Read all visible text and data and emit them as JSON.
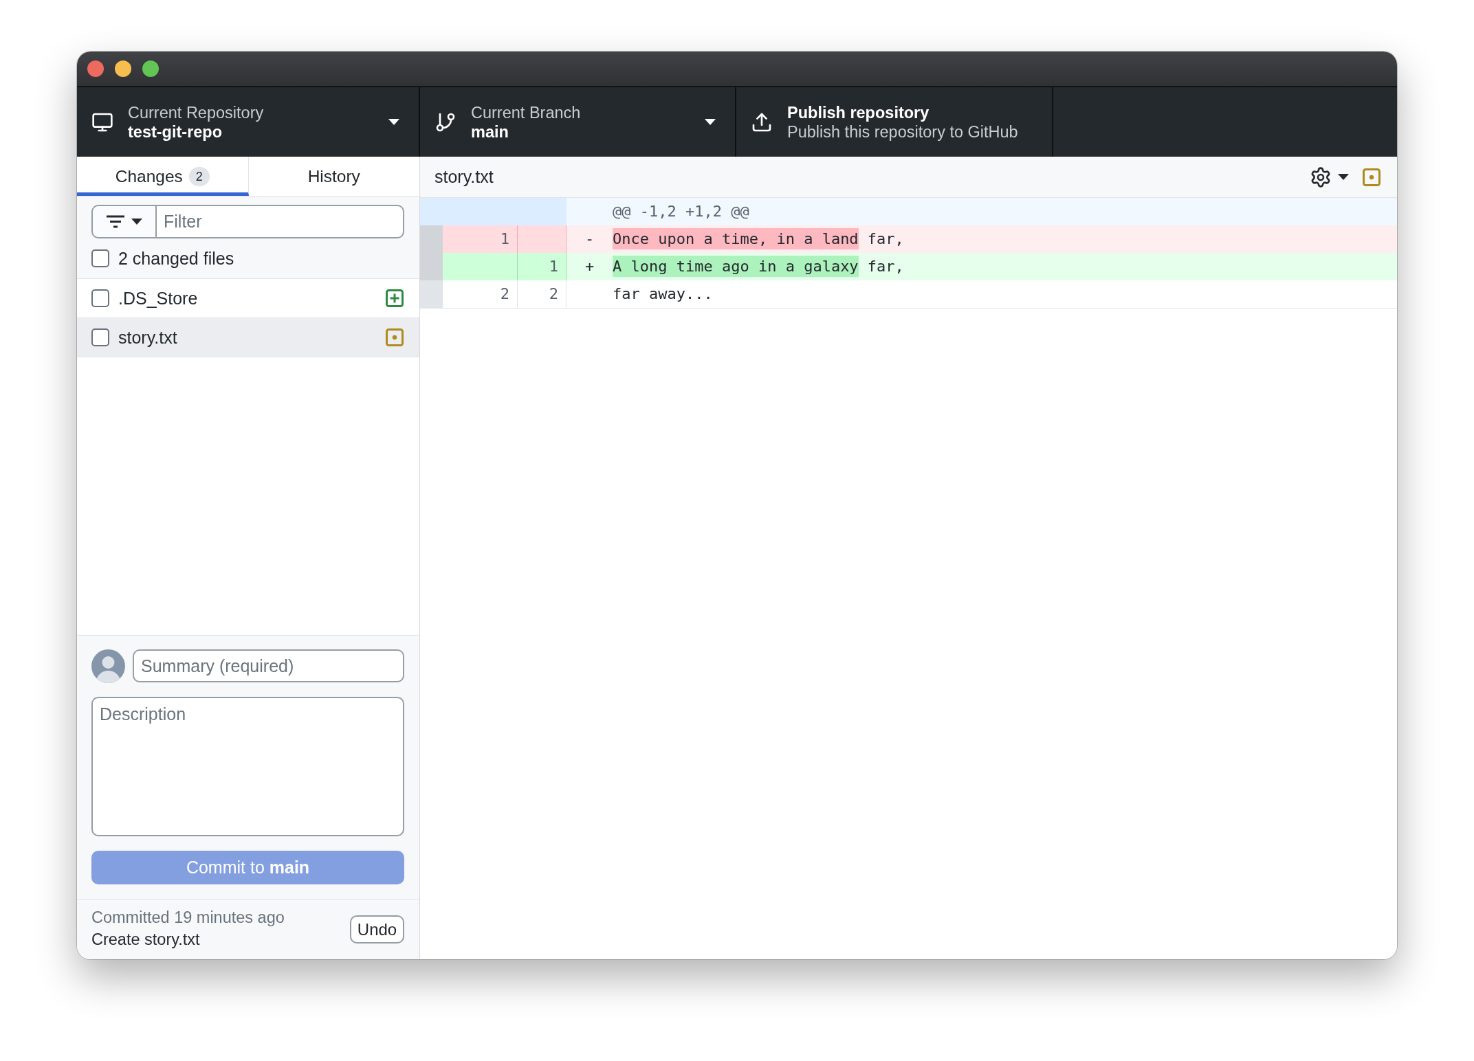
{
  "toolbar": [
    {
      "kind": "repository",
      "label": "Current Repository",
      "value": "test-git-repo",
      "dropdown": true
    },
    {
      "kind": "branch",
      "label": "Current Branch",
      "value": "main",
      "dropdown": true
    },
    {
      "kind": "publish",
      "title": "Publish repository",
      "description": "Publish this repository to GitHub"
    }
  ],
  "sidebar": {
    "tabs": [
      {
        "label": "Changes",
        "count": "2",
        "selected": true
      },
      {
        "label": "History",
        "selected": false
      }
    ],
    "filter": {
      "placeholder": "Filter"
    },
    "select_all": {
      "label": "2 changed files",
      "checked": false
    },
    "files": [
      {
        "name": ".DS_Store",
        "kind": "added",
        "checked": false,
        "selected": false
      },
      {
        "name": "story.txt",
        "kind": "modified",
        "checked": false,
        "selected": true
      }
    ],
    "commit": {
      "summary": {
        "placeholder": "Summary (required)"
      },
      "description": {
        "placeholder": "Description"
      },
      "button": {
        "label": "Commit to **main**",
        "disabled": true
      }
    },
    "last_commit": {
      "status": "Committed 19 minutes ago",
      "message": "Create story.txt",
      "undo": "Undo"
    }
  },
  "diff": {
    "file": "story.txt",
    "hunk": "@@ -1,2 +1,2 @@",
    "lines": [
      {
        "kind": "deleted",
        "old": "1",
        "sign": "-",
        "segments": [
          {
            "text": "Once upon a time, in a land",
            "highlight": true
          },
          {
            "text": " far,",
            "highlight": false
          }
        ]
      },
      {
        "kind": "added",
        "new": "1",
        "sign": "+",
        "segments": [
          {
            "text": "A long time ago in a galaxy",
            "highlight": true
          },
          {
            "text": " far,",
            "highlight": false
          }
        ]
      },
      {
        "kind": "context",
        "old": "2",
        "new": "2",
        "segments": [
          {
            "text": "far away...",
            "highlight": false
          }
        ]
      }
    ]
  }
}
